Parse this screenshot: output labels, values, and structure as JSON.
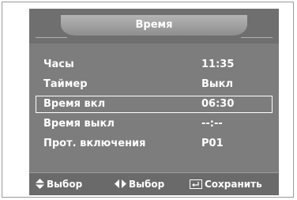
{
  "title": "Время",
  "menu": [
    {
      "label": "Часы",
      "value": "11:35"
    },
    {
      "label": "Таймер",
      "value": "Выкл"
    },
    {
      "label": "Время вкл",
      "value": "06:30"
    },
    {
      "label": "Время выкл",
      "value": "--:--"
    },
    {
      "label": "Прот. включения",
      "value": "P01"
    }
  ],
  "hints": {
    "move": "Выбор",
    "adjust": "Выбор",
    "save": "Сохранить"
  },
  "icons": {
    "move": "up-down-arrows-icon",
    "adjust": "left-right-arrows-icon",
    "save": "enter-icon"
  },
  "colors": {
    "panel": "#7d7d7d",
    "bar": "#6a6a6a",
    "text": "#ffffff"
  }
}
